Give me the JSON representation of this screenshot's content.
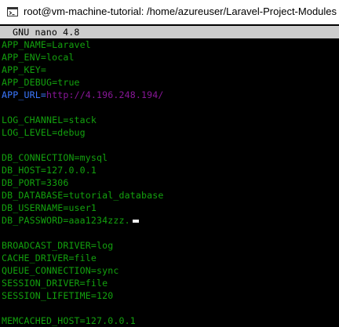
{
  "window": {
    "title": "root@vm-machine-tutorial: /home/azureuser/Laravel-Project-Modules"
  },
  "icons": {
    "title_icon": "console-window-icon"
  },
  "colors": {
    "key_text": "#13a10e",
    "url_key": "#3b78ff",
    "url_value": "#881798",
    "header_bg": "#cccccc",
    "background": "#000000"
  },
  "editor": {
    "header": "GNU nano 4.8",
    "lines": {
      "app_name": "APP_NAME=Laravel",
      "app_env": "APP_ENV=local",
      "app_key": "APP_KEY=",
      "app_debug": "APP_DEBUG=true",
      "app_url_key": "APP_URL=",
      "app_url_value": "http://4.196.248.194/",
      "log_channel": "LOG_CHANNEL=stack",
      "log_level": "LOG_LEVEL=debug",
      "db_connection": "DB_CONNECTION=mysql",
      "db_host": "DB_HOST=127.0.0.1",
      "db_port": "DB_PORT=3306",
      "db_database": "DB_DATABASE=tutorial_database",
      "db_username": "DB_USERNAME=user1",
      "db_password": "DB_PASSWORD=aaa1234zzz.",
      "broadcast_driver": "BROADCAST_DRIVER=log",
      "cache_driver": "CACHE_DRIVER=file",
      "queue_connection": "QUEUE_CONNECTION=sync",
      "session_driver": "SESSION_DRIVER=file",
      "session_lifetime": "SESSION_LIFETIME=120",
      "memcached_host": "MEMCACHED_HOST=127.0.0.1"
    }
  }
}
